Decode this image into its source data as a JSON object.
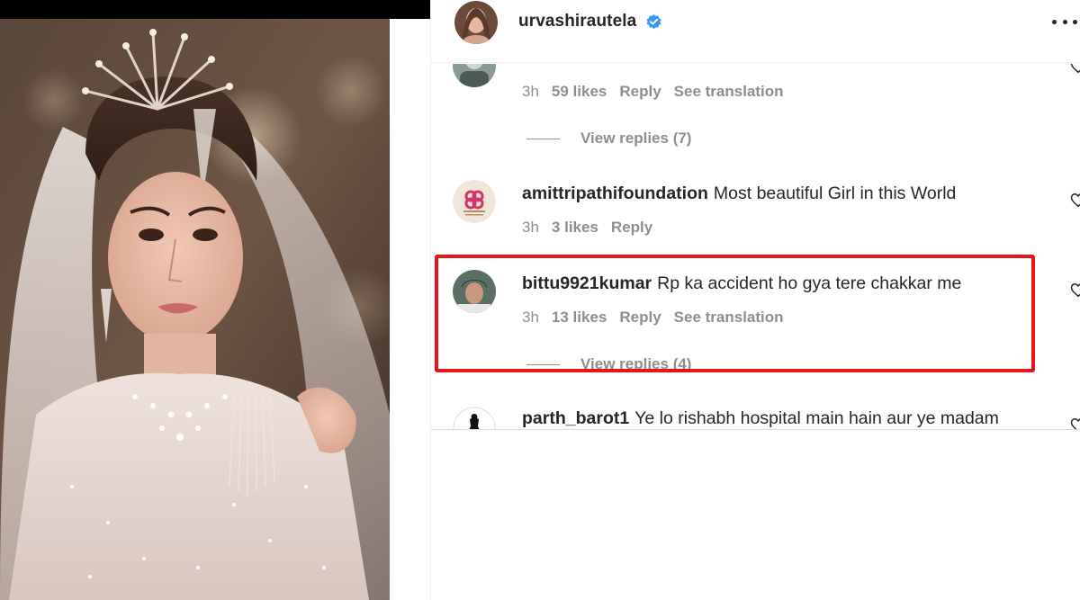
{
  "post_header": {
    "username": "urvashirautela",
    "verified_icon": "verified-badge-icon",
    "more_icon": "more-options-icon"
  },
  "comments": [
    {
      "username": "",
      "text": "",
      "time": "3h",
      "likes": "59 likes",
      "reply": "Reply",
      "translate": "See translation",
      "view_replies": "View replies (7)"
    },
    {
      "username": "amittripathifoundation",
      "text": "Most beautiful Girl in this World",
      "time": "3h",
      "likes": "3 likes",
      "reply": "Reply",
      "translate": "",
      "view_replies": ""
    },
    {
      "username": "bittu9921kumar",
      "text": "Rp ka accident ho gya tere chakkar me",
      "time": "3h",
      "likes": "13 likes",
      "reply": "Reply",
      "translate": "See translation",
      "view_replies": "View replies (4)"
    },
    {
      "username": "parth_barot1",
      "text": "Ye lo rishabh hospital main hain aur ye madam",
      "time": "",
      "likes": "",
      "reply": "",
      "translate": "",
      "view_replies": ""
    }
  ],
  "colors": {
    "highlight": "#e8141b",
    "verified": "#3897f0",
    "muted_text": "#8e8e8e"
  }
}
